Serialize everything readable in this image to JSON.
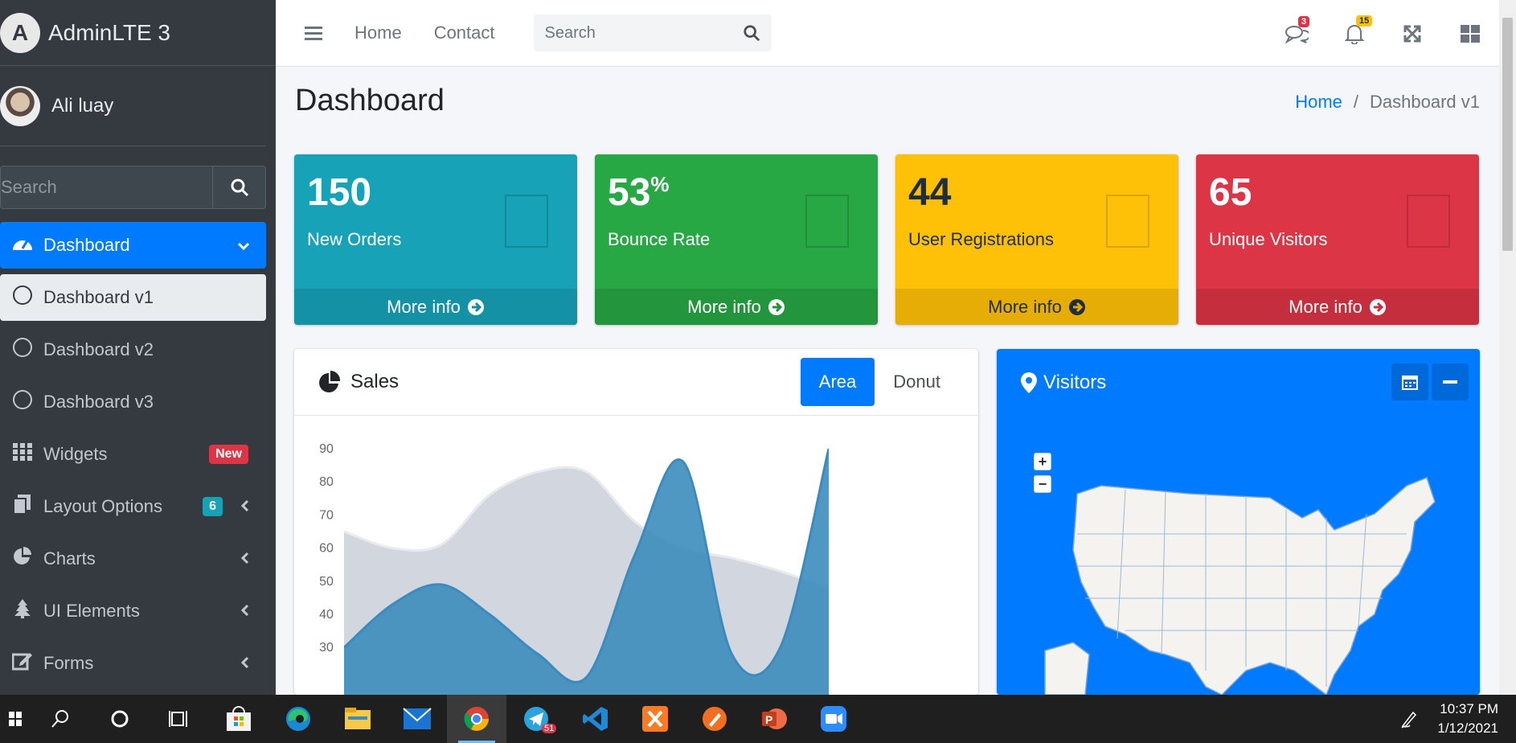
{
  "brand": {
    "name": "AdminLTE 3",
    "logo_letter": "A"
  },
  "user": {
    "name": "Ali luay"
  },
  "sidebar": {
    "search_placeholder": "Search",
    "items": [
      {
        "label": "Dashboard",
        "icon": "tachometer-icon",
        "state": "active"
      },
      {
        "label": "Dashboard v1",
        "icon": "circle-icon",
        "state": "sub-active"
      },
      {
        "label": "Dashboard v2",
        "icon": "circle-icon"
      },
      {
        "label": "Dashboard v3",
        "icon": "circle-icon"
      },
      {
        "label": "Widgets",
        "icon": "grid-icon",
        "badge": "New"
      },
      {
        "label": "Layout Options",
        "icon": "copy-icon",
        "badge": "6"
      },
      {
        "label": "Charts",
        "icon": "pie-chart-icon"
      },
      {
        "label": "UI Elements",
        "icon": "tree-icon"
      },
      {
        "label": "Forms",
        "icon": "edit-icon"
      }
    ]
  },
  "topnav": {
    "links": [
      "Home",
      "Contact"
    ],
    "search_placeholder": "Search",
    "messages_count": "3",
    "notifications_count": "15"
  },
  "header": {
    "title": "Dashboard",
    "breadcrumb": [
      "Home",
      "Dashboard v1"
    ]
  },
  "small_boxes": [
    {
      "value": "150",
      "suffix": "",
      "label": "New Orders",
      "footer": "More info",
      "color": "#17a2b8"
    },
    {
      "value": "53",
      "suffix": "%",
      "label": "Bounce Rate",
      "footer": "More info",
      "color": "#28a745"
    },
    {
      "value": "44",
      "suffix": "",
      "label": "User Registrations",
      "footer": "More info",
      "color": "#ffc107"
    },
    {
      "value": "65",
      "suffix": "",
      "label": "Unique Visitors",
      "footer": "More info",
      "color": "#dc3545"
    }
  ],
  "sales": {
    "title": "Sales",
    "tabs": [
      "Area",
      "Donut"
    ],
    "active_tab": "Area"
  },
  "visitors": {
    "title": "Visitors"
  },
  "chart_data": {
    "type": "area",
    "title": "",
    "xlabel": "",
    "ylabel": "",
    "ylim": [
      30,
      90
    ],
    "yticks": [
      90,
      80,
      70,
      60,
      50,
      40,
      30
    ],
    "grid": false,
    "series": [
      {
        "values": [
          65,
          60,
          61,
          76,
          83,
          83,
          68,
          60,
          57,
          53,
          48
        ],
        "color": "#d2d6de"
      },
      {
        "values": [
          30,
          43,
          49,
          40,
          28,
          21,
          58,
          86,
          28,
          30,
          90
        ],
        "color": "#3c8dbc"
      }
    ]
  },
  "taskbar": {
    "apps": [
      "windows-icon",
      "search-icon",
      "cortana-icon",
      "task-view-icon",
      "store-icon",
      "edge-icon",
      "file-explorer-icon",
      "mail-icon",
      "chrome-icon",
      "telegram-icon",
      "vscode-icon",
      "xampp-icon",
      "draw-icon",
      "powerpoint-icon",
      "zoom-icon"
    ],
    "telegram_badge": "51",
    "time": "10:37 PM",
    "date": "1/12/2021"
  }
}
